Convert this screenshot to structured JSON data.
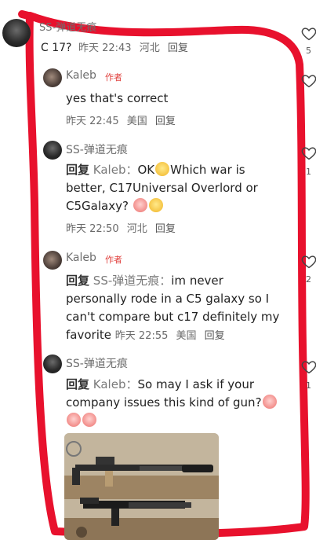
{
  "top_comment": {
    "author": "SS-弹道无痕",
    "text": "C 17?",
    "time": "昨天 22:43",
    "location": "河北",
    "reply_label": "回复",
    "like_count": "5"
  },
  "replies": [
    {
      "author": "Kaleb",
      "badge": "作者",
      "text": "yes that's correct",
      "time": "昨天 22:45",
      "location": "美国",
      "reply_label": "回复",
      "like_count": ""
    },
    {
      "author": "SS-弹道无痕",
      "reply_prefix": "回复",
      "reply_to": "Kaleb：",
      "text_parts": [
        "OK",
        "Which war is better, C17Universal Overlord or C5Galaxy?"
      ],
      "time": "昨天 22:50",
      "location": "河北",
      "reply_label": "回复",
      "like_count": "1"
    },
    {
      "author": "Kaleb",
      "badge": "作者",
      "reply_prefix": "回复",
      "reply_to": "SS-弹道无痕：",
      "text": "im never personally rode in a C5 galaxy so I can't compare but c17 definitely my favorite",
      "time": "昨天 22:55",
      "location": "美国",
      "reply_label": "回复",
      "like_count": "2"
    },
    {
      "author": "SS-弹道无痕",
      "reply_prefix": "回复",
      "reply_to": "Kaleb：",
      "text": "So may I ask if your company issues this kind of gun?",
      "like_count": "1"
    }
  ],
  "colors": {
    "annotation_red": "#e8112d",
    "badge_red": "#e0413e",
    "meta_gray": "#6a6a6a"
  },
  "icons": {
    "like": "heart-outline-icon",
    "emoji_1": "yellow-face-emoji",
    "emoji_2": "pink-face-emoji"
  }
}
